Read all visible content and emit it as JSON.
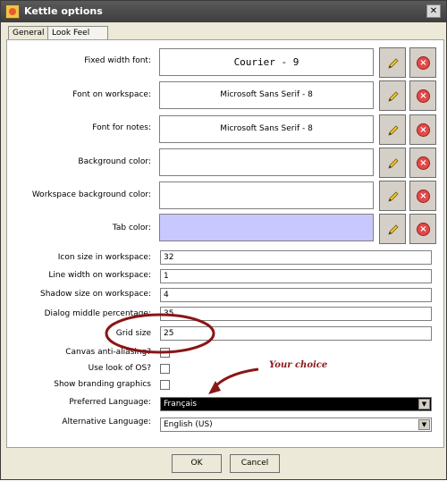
{
  "window": {
    "title": "Kettle options",
    "close_glyph": "✕",
    "app_icon": "kettle-icon"
  },
  "tabs": [
    {
      "label": "General",
      "active": false
    },
    {
      "label": "Look Feel",
      "active": true
    }
  ],
  "font_rows": [
    {
      "label": "Fixed width font:",
      "value": "Courier - 9"
    },
    {
      "label": "Font on workspace:",
      "value": "Microsoft Sans Serif - 8"
    },
    {
      "label": "Font for notes:",
      "value": "Microsoft Sans Serif - 8"
    }
  ],
  "color_rows": [
    {
      "label": "Background color:",
      "value": "",
      "color": "#ffffff"
    },
    {
      "label": "Workspace background color:",
      "value": "",
      "color": "#ffffff"
    },
    {
      "label": "Tab color:",
      "value": "",
      "color": "#c8c8ff"
    }
  ],
  "icons": {
    "edit": "pencil-icon",
    "reset": "delete-x-icon"
  },
  "fields": [
    {
      "label": "Icon size in workspace:",
      "value": "32"
    },
    {
      "label": "Line width on workspace:",
      "value": "1"
    },
    {
      "label": "Shadow size on workspace:",
      "value": "4"
    },
    {
      "label": "Dialog middle percentage:",
      "value": "35"
    },
    {
      "label": "Grid size",
      "value": "25"
    }
  ],
  "checks": [
    {
      "label": "Canvas anti-aliasing?",
      "checked": false
    },
    {
      "label": "Use look of OS?",
      "checked": false
    },
    {
      "label": "Show branding graphics",
      "checked": false
    }
  ],
  "languages": {
    "preferred_label": "Preferred Language:",
    "preferred_value": "Français",
    "alternative_label": "Alternative Language:",
    "alternative_value": "English (US)"
  },
  "buttons": {
    "ok": "OK",
    "cancel": "Cancel"
  },
  "annotation": {
    "text": "Your choice",
    "color": "#8a1616"
  }
}
